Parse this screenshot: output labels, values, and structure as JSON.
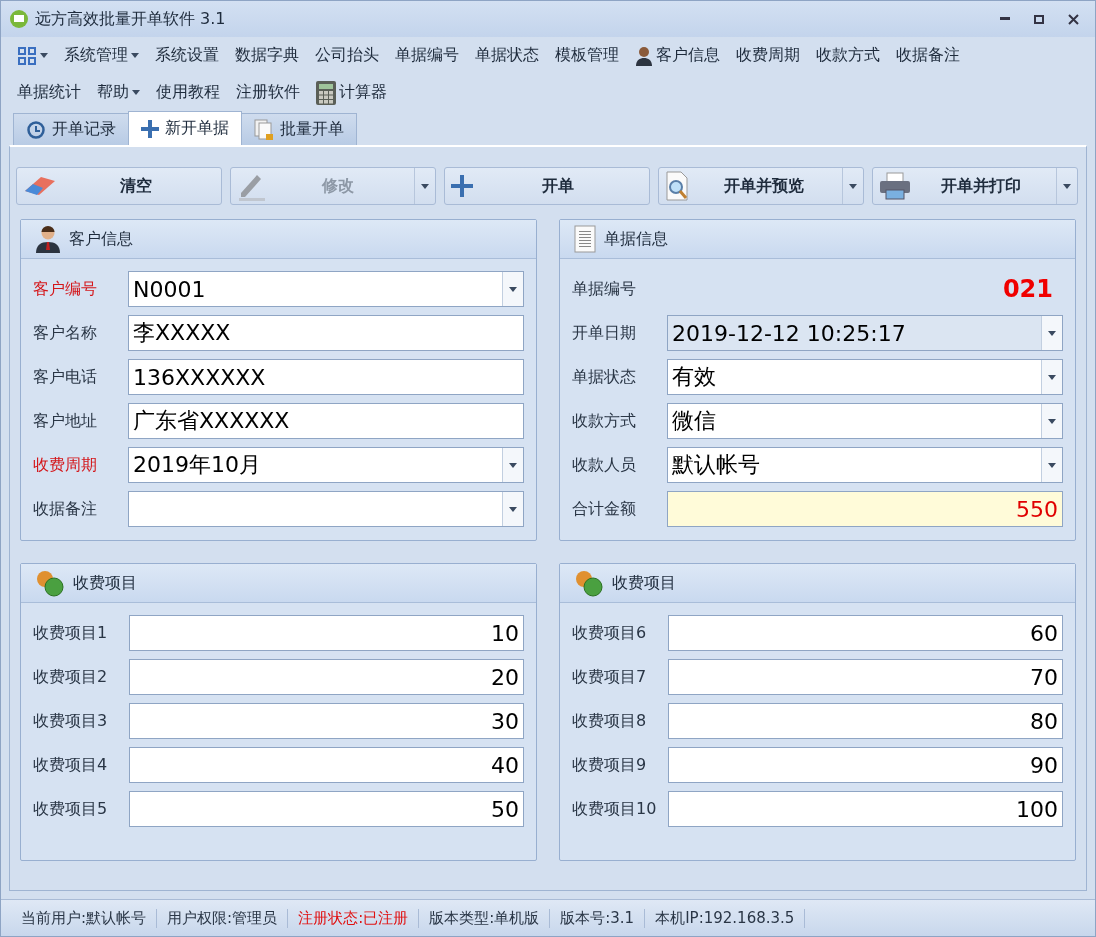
{
  "window": {
    "title": "远方高效批量开单软件 3.1"
  },
  "menu": [
    {
      "dropdown": true
    },
    {
      "label": "系统管理",
      "dropdown": true
    },
    {
      "label": "系统设置",
      "dropdown": false
    },
    {
      "label": "数据字典",
      "dropdown": false
    },
    {
      "label": "公司抬头",
      "dropdown": false
    },
    {
      "label": "单据编号",
      "dropdown": false
    },
    {
      "label": "单据状态",
      "dropdown": false
    },
    {
      "label": "模板管理",
      "dropdown": false
    },
    {
      "label": "客户信息",
      "dropdown": false
    },
    {
      "label": "收费周期",
      "dropdown": false
    },
    {
      "label": "收款方式",
      "dropdown": false
    },
    {
      "label": "收据备注",
      "dropdown": false
    },
    {
      "label": "单据统计",
      "dropdown": false
    },
    {
      "label": "帮助",
      "dropdown": true
    },
    {
      "label": "使用教程",
      "dropdown": false
    },
    {
      "label": "注册软件",
      "dropdown": false
    },
    {
      "label": "计算器",
      "dropdown": false
    }
  ],
  "tabs": [
    {
      "label": "开单记录",
      "selected": false
    },
    {
      "label": "新开单据",
      "selected": true
    },
    {
      "label": "批量开单",
      "selected": false
    }
  ],
  "toolbar": [
    {
      "label": "清空",
      "disabled": false,
      "split": false
    },
    {
      "label": "修改",
      "disabled": true,
      "split": true
    },
    {
      "label": "开单",
      "disabled": false,
      "split": false
    },
    {
      "label": "开单并预览",
      "disabled": false,
      "split": true
    },
    {
      "label": "开单并打印",
      "disabled": false,
      "split": true
    }
  ],
  "customer_panel": {
    "title": "客户信息",
    "fields": [
      {
        "label": "客户编号",
        "value": "N0001",
        "required": true,
        "dropdown": true
      },
      {
        "label": "客户名称",
        "value": "李XXXXX",
        "required": false,
        "dropdown": false
      },
      {
        "label": "客户电话",
        "value": "136XXXXXX",
        "required": false,
        "dropdown": false
      },
      {
        "label": "客户地址",
        "value": "广东省XXXXXX",
        "required": false,
        "dropdown": false
      },
      {
        "label": "收费周期",
        "value": "2019年10月",
        "required": true,
        "dropdown": true
      },
      {
        "label": "收据备注",
        "required": false,
        "dropdown": true
      }
    ]
  },
  "invoice_panel": {
    "title": "单据信息",
    "fields": [
      {
        "kind": "code",
        "label": "单据编号",
        "value": "021"
      },
      {
        "kind": "readonly-combo",
        "label": "开单日期",
        "value": "2019-12-12 10:25:17"
      },
      {
        "kind": "combo",
        "label": "单据状态",
        "value": "有效"
      },
      {
        "kind": "combo",
        "label": "收款方式",
        "value": "微信"
      },
      {
        "kind": "combo",
        "label": "收款人员",
        "value": "默认帐号"
      },
      {
        "kind": "total",
        "label": "合计金额",
        "value": "550"
      }
    ]
  },
  "fee_panels": [
    {
      "title": "收费项目",
      "items": [
        {
          "label": "收费项目1",
          "value": "10"
        },
        {
          "label": "收费项目2",
          "value": "20"
        },
        {
          "label": "收费项目3",
          "value": "30"
        },
        {
          "label": "收费项目4",
          "value": "40"
        },
        {
          "label": "收费项目5",
          "value": "50"
        }
      ]
    },
    {
      "title": "收费项目",
      "items": [
        {
          "label": "收费项目6",
          "value": "60"
        },
        {
          "label": "收费项目7",
          "value": "70"
        },
        {
          "label": "收费项目8",
          "value": "80"
        },
        {
          "label": "收费项目9",
          "value": "90"
        },
        {
          "label": "收费项目10",
          "value": "100"
        }
      ]
    }
  ],
  "status_bar": [
    {
      "text": "当前用户:默认帐号",
      "highlight": false
    },
    {
      "text": "用户权限:管理员",
      "highlight": false
    },
    {
      "text": "注册状态:已注册",
      "highlight": true
    },
    {
      "text": "版本类型:单机版",
      "highlight": false
    },
    {
      "text": "版本号:3.1",
      "highlight": false
    },
    {
      "text": "本机IP:192.168.3.5",
      "highlight": false
    }
  ]
}
